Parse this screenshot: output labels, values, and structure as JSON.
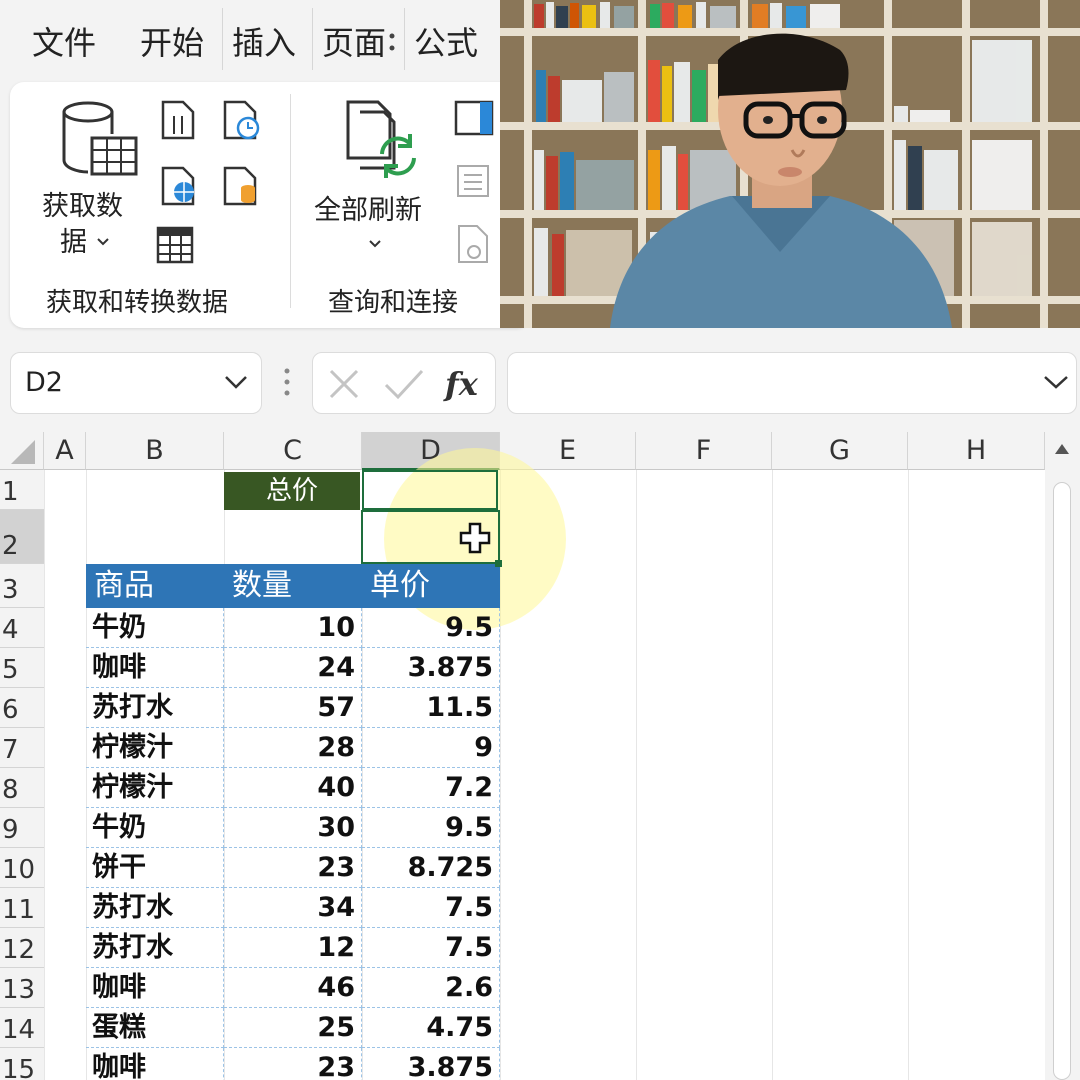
{
  "ribbon": {
    "tabs": [
      "文件",
      "开始",
      "插入",
      "页面",
      "公式"
    ],
    "get_data_label_line1": "获取数",
    "get_data_label_line2": "据",
    "refresh_all_label": "全部刷新",
    "group_get_transform": "获取和转换数据",
    "group_queries": "查询和连接"
  },
  "formula_bar": {
    "name_box": "D2",
    "formula_value": ""
  },
  "sheet": {
    "columns": [
      "A",
      "B",
      "C",
      "D",
      "E",
      "F",
      "G",
      "H"
    ],
    "rows": [
      "1",
      "2",
      "3",
      "4",
      "5",
      "6",
      "7",
      "8",
      "9",
      "10",
      "11",
      "12",
      "13",
      "14",
      "15"
    ],
    "selected_cell": "D2",
    "total_label": "总价",
    "table": {
      "headers": [
        "商品",
        "数量",
        "单价"
      ],
      "rows": [
        [
          "牛奶",
          "10",
          "9.5"
        ],
        [
          "咖啡",
          "24",
          "3.875"
        ],
        [
          "苏打水",
          "57",
          "11.5"
        ],
        [
          "柠檬汁",
          "28",
          "9"
        ],
        [
          "柠檬汁",
          "40",
          "7.2"
        ],
        [
          "牛奶",
          "30",
          "9.5"
        ],
        [
          "饼干",
          "23",
          "8.725"
        ],
        [
          "苏打水",
          "34",
          "7.5"
        ],
        [
          "苏打水",
          "12",
          "7.5"
        ],
        [
          "咖啡",
          "46",
          "2.6"
        ],
        [
          "蛋糕",
          "25",
          "4.75"
        ],
        [
          "咖啡",
          "23",
          "3.875"
        ]
      ]
    }
  },
  "colors": {
    "table_header": "#2e75b6",
    "total_label_bg": "#385723",
    "selection": "#1e6e3c"
  }
}
